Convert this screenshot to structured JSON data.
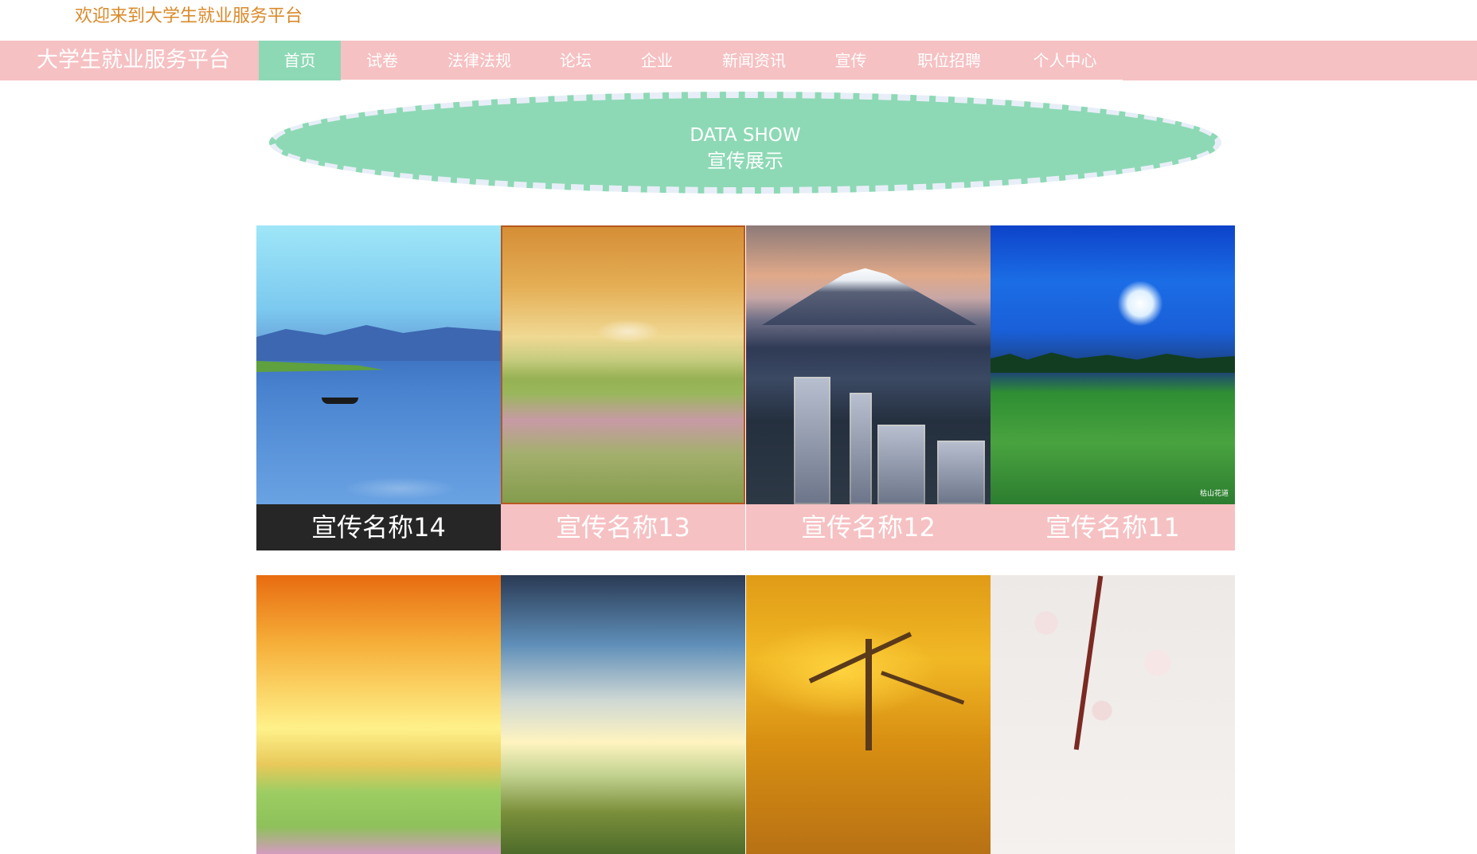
{
  "header": {
    "welcome": "欢迎来到大学生就业服务平台"
  },
  "navbar": {
    "brand": "大学生就业服务平台",
    "items": [
      {
        "label": "首页",
        "active": true
      },
      {
        "label": "试卷"
      },
      {
        "label": "法律法规"
      },
      {
        "label": "论坛"
      },
      {
        "label": "企业"
      },
      {
        "label": "新闻资讯"
      },
      {
        "label": "宣传"
      },
      {
        "label": "职位招聘"
      },
      {
        "label": "个人中心"
      }
    ]
  },
  "section": {
    "title_en": "DATA SHOW",
    "title_zh": "宣传展示"
  },
  "cards": [
    {
      "name": "宣传名称14",
      "image": "lake-boat"
    },
    {
      "name": "宣传名称13",
      "image": "flower-field"
    },
    {
      "name": "宣传名称12",
      "image": "mountain-city"
    },
    {
      "name": "宣传名称11",
      "image": "moonlit-meadow",
      "watermark": "枯山花道"
    },
    {
      "name": "",
      "image": "sunset-field"
    },
    {
      "name": "",
      "image": "cloudy-sky"
    },
    {
      "name": "",
      "image": "autumn-trees"
    },
    {
      "name": "",
      "image": "cherry-blossom"
    }
  ],
  "colors": {
    "accent_pink": "#f6c1c3",
    "accent_green": "#8dd9b5",
    "welcome_text": "#d98a2a",
    "active_card_label": "#262626"
  }
}
